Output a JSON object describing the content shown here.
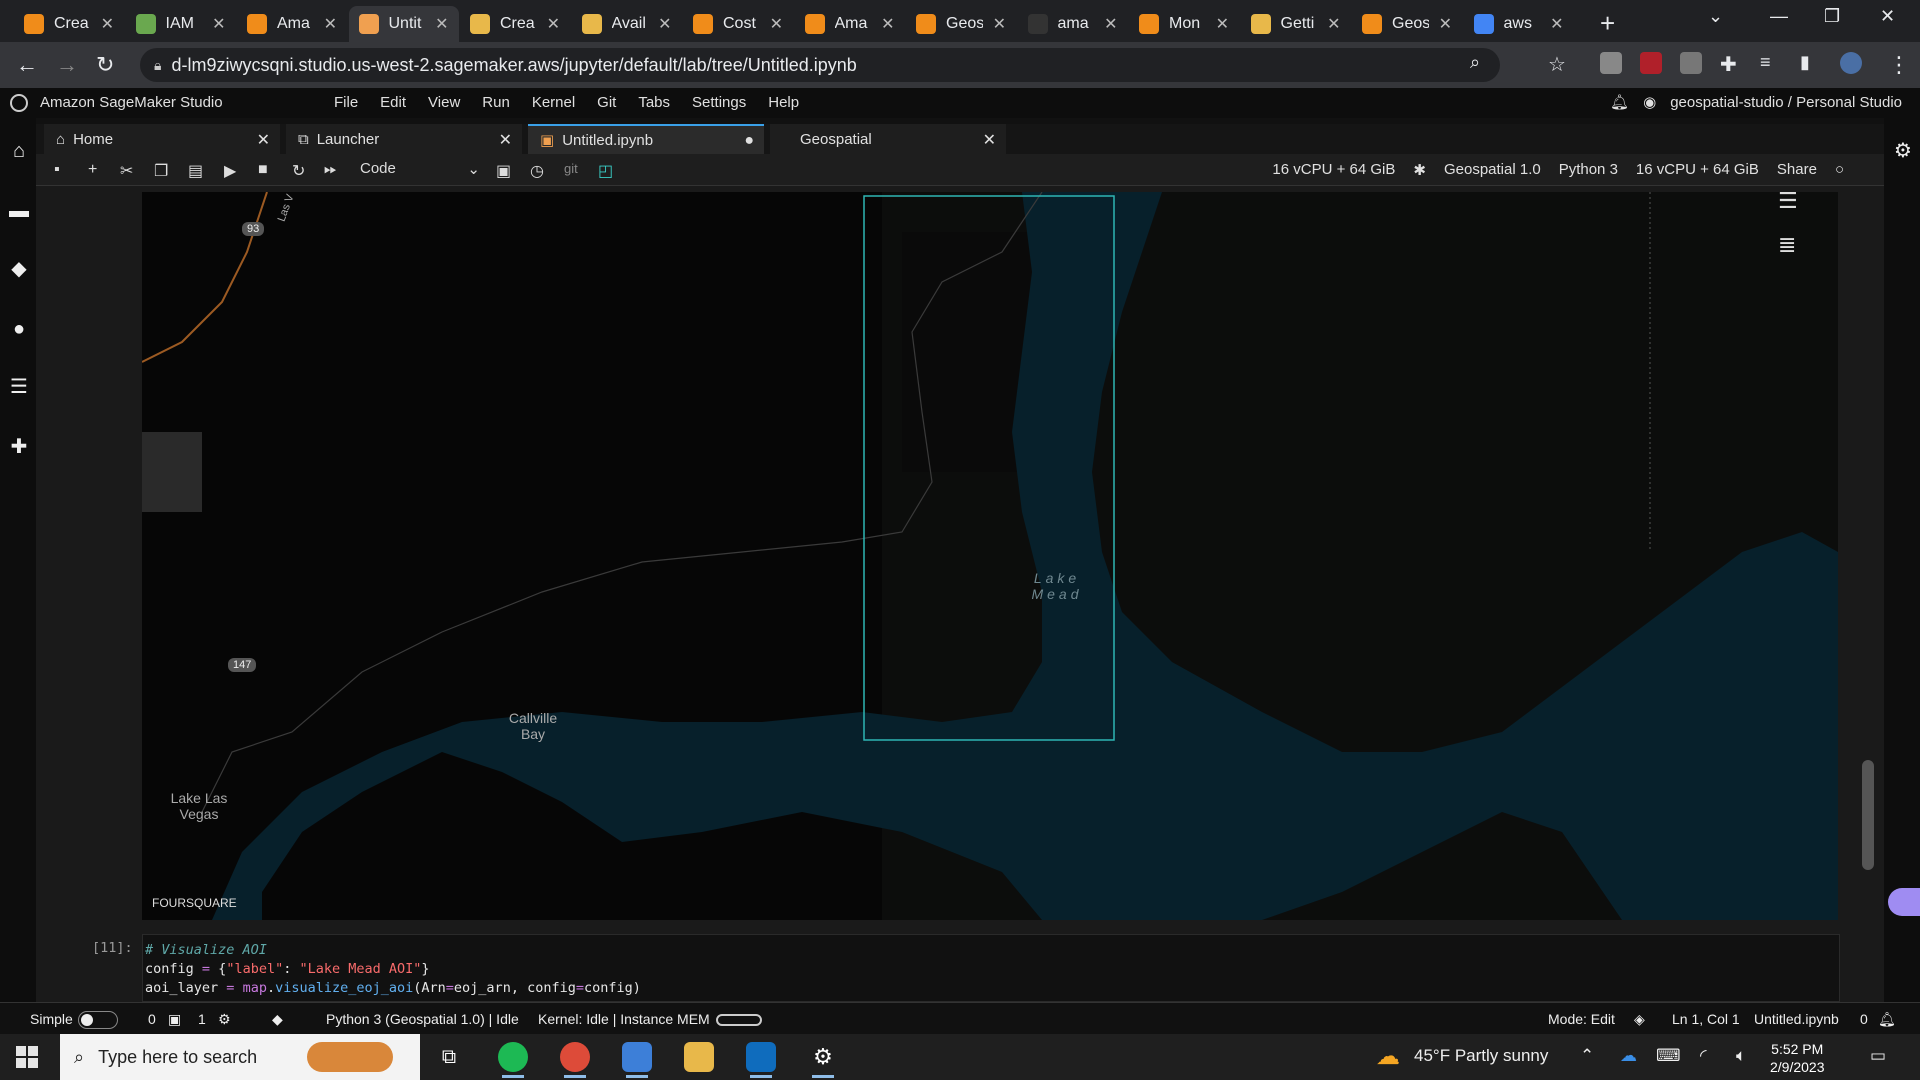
{
  "browser": {
    "tabs": [
      {
        "title": "Crea",
        "color": "#f08c1a",
        "active": false
      },
      {
        "title": "IAM",
        "color": "#6aa84f",
        "active": false
      },
      {
        "title": "Ama",
        "color": "#f08c1a",
        "active": false
      },
      {
        "title": "Untit",
        "color": "#f0a050",
        "active": true
      },
      {
        "title": "Crea",
        "color": "#e8b84a",
        "active": false
      },
      {
        "title": "Avail",
        "color": "#e8b84a",
        "active": false
      },
      {
        "title": "Cost",
        "color": "#f08c1a",
        "active": false
      },
      {
        "title": "Ama",
        "color": "#f08c1a",
        "active": false
      },
      {
        "title": "Geos",
        "color": "#f08c1a",
        "active": false
      },
      {
        "title": "ama",
        "color": "#333333",
        "active": false
      },
      {
        "title": "Mon",
        "color": "#f08c1a",
        "active": false
      },
      {
        "title": "Getti",
        "color": "#e8b84a",
        "active": false
      },
      {
        "title": "Geos",
        "color": "#f08c1a",
        "active": false
      },
      {
        "title": "aws",
        "color": "#4285f4",
        "active": false
      }
    ],
    "url": "d-lm9ziwycsqni.studio.us-west-2.sagemaker.aws/jupyter/default/lab/tree/Untitled.ipynb"
  },
  "studio": {
    "title": "Amazon SageMaker Studio",
    "menu": [
      "File",
      "Edit",
      "View",
      "Run",
      "Kernel",
      "Git",
      "Tabs",
      "Settings",
      "Help"
    ],
    "user": "geospatial-studio / Personal Studio"
  },
  "doc_tabs": [
    {
      "label": "Home",
      "icon": "home-icon"
    },
    {
      "label": "Launcher",
      "icon": "launcher-icon"
    },
    {
      "label": "Untitled.ipynb",
      "icon": "notebook-icon"
    },
    {
      "label": "Geospatial",
      "icon": ""
    }
  ],
  "toolbar": {
    "cell_type": "Code",
    "git_label": "git",
    "instance_left": "16 vCPU + 64 GiB",
    "image": "Geospatial 1.0",
    "kernel": "Python 3",
    "instance_right": "16 vCPU + 64 GiB",
    "share": "Share"
  },
  "map": {
    "labels": {
      "lake_mead": "Lake Mead",
      "callville_bay": "Callville Bay",
      "lake_las_vegas": "Lake Las Vegas",
      "road_las_v": "Las V"
    },
    "shields": {
      "route_93": "93",
      "route_147": "147"
    },
    "attribution": "FOURSQUARE"
  },
  "cell": {
    "prompt": "[11]:",
    "comment": "# Visualize AOI",
    "line2_a": "config ",
    "line2_op": "=",
    "line2_b": " {",
    "line2_key": "\"label\"",
    "line2_c": ": ",
    "line2_val": "\"Lake Mead AOI\"",
    "line2_d": "}",
    "line3_a": "aoi_layer ",
    "line3_op": "=",
    "line3_b": " ",
    "line3_map": "map",
    "line3_dot": ".",
    "line3_fn": "visualize_eoj_aoi",
    "line3_c": "(Arn",
    "line3_op2": "=",
    "line3_d": "eoj_arn, config",
    "line3_op3": "=",
    "line3_e": "config)"
  },
  "statusbar": {
    "mode_simple": "Simple",
    "count_a": "0",
    "count_b": "1",
    "kernel_status": "Python 3 (Geospatial 1.0) | Idle",
    "kernel_idle": "Kernel: Idle | Instance MEM",
    "mode": "Mode: Edit",
    "position": "Ln 1, Col 1",
    "file": "Untitled.ipynb",
    "notifications": "0"
  },
  "taskbar": {
    "search_placeholder": "Type here to search",
    "weather": "45°F  Partly sunny",
    "time": "5:52 PM",
    "date": "2/9/2023"
  }
}
